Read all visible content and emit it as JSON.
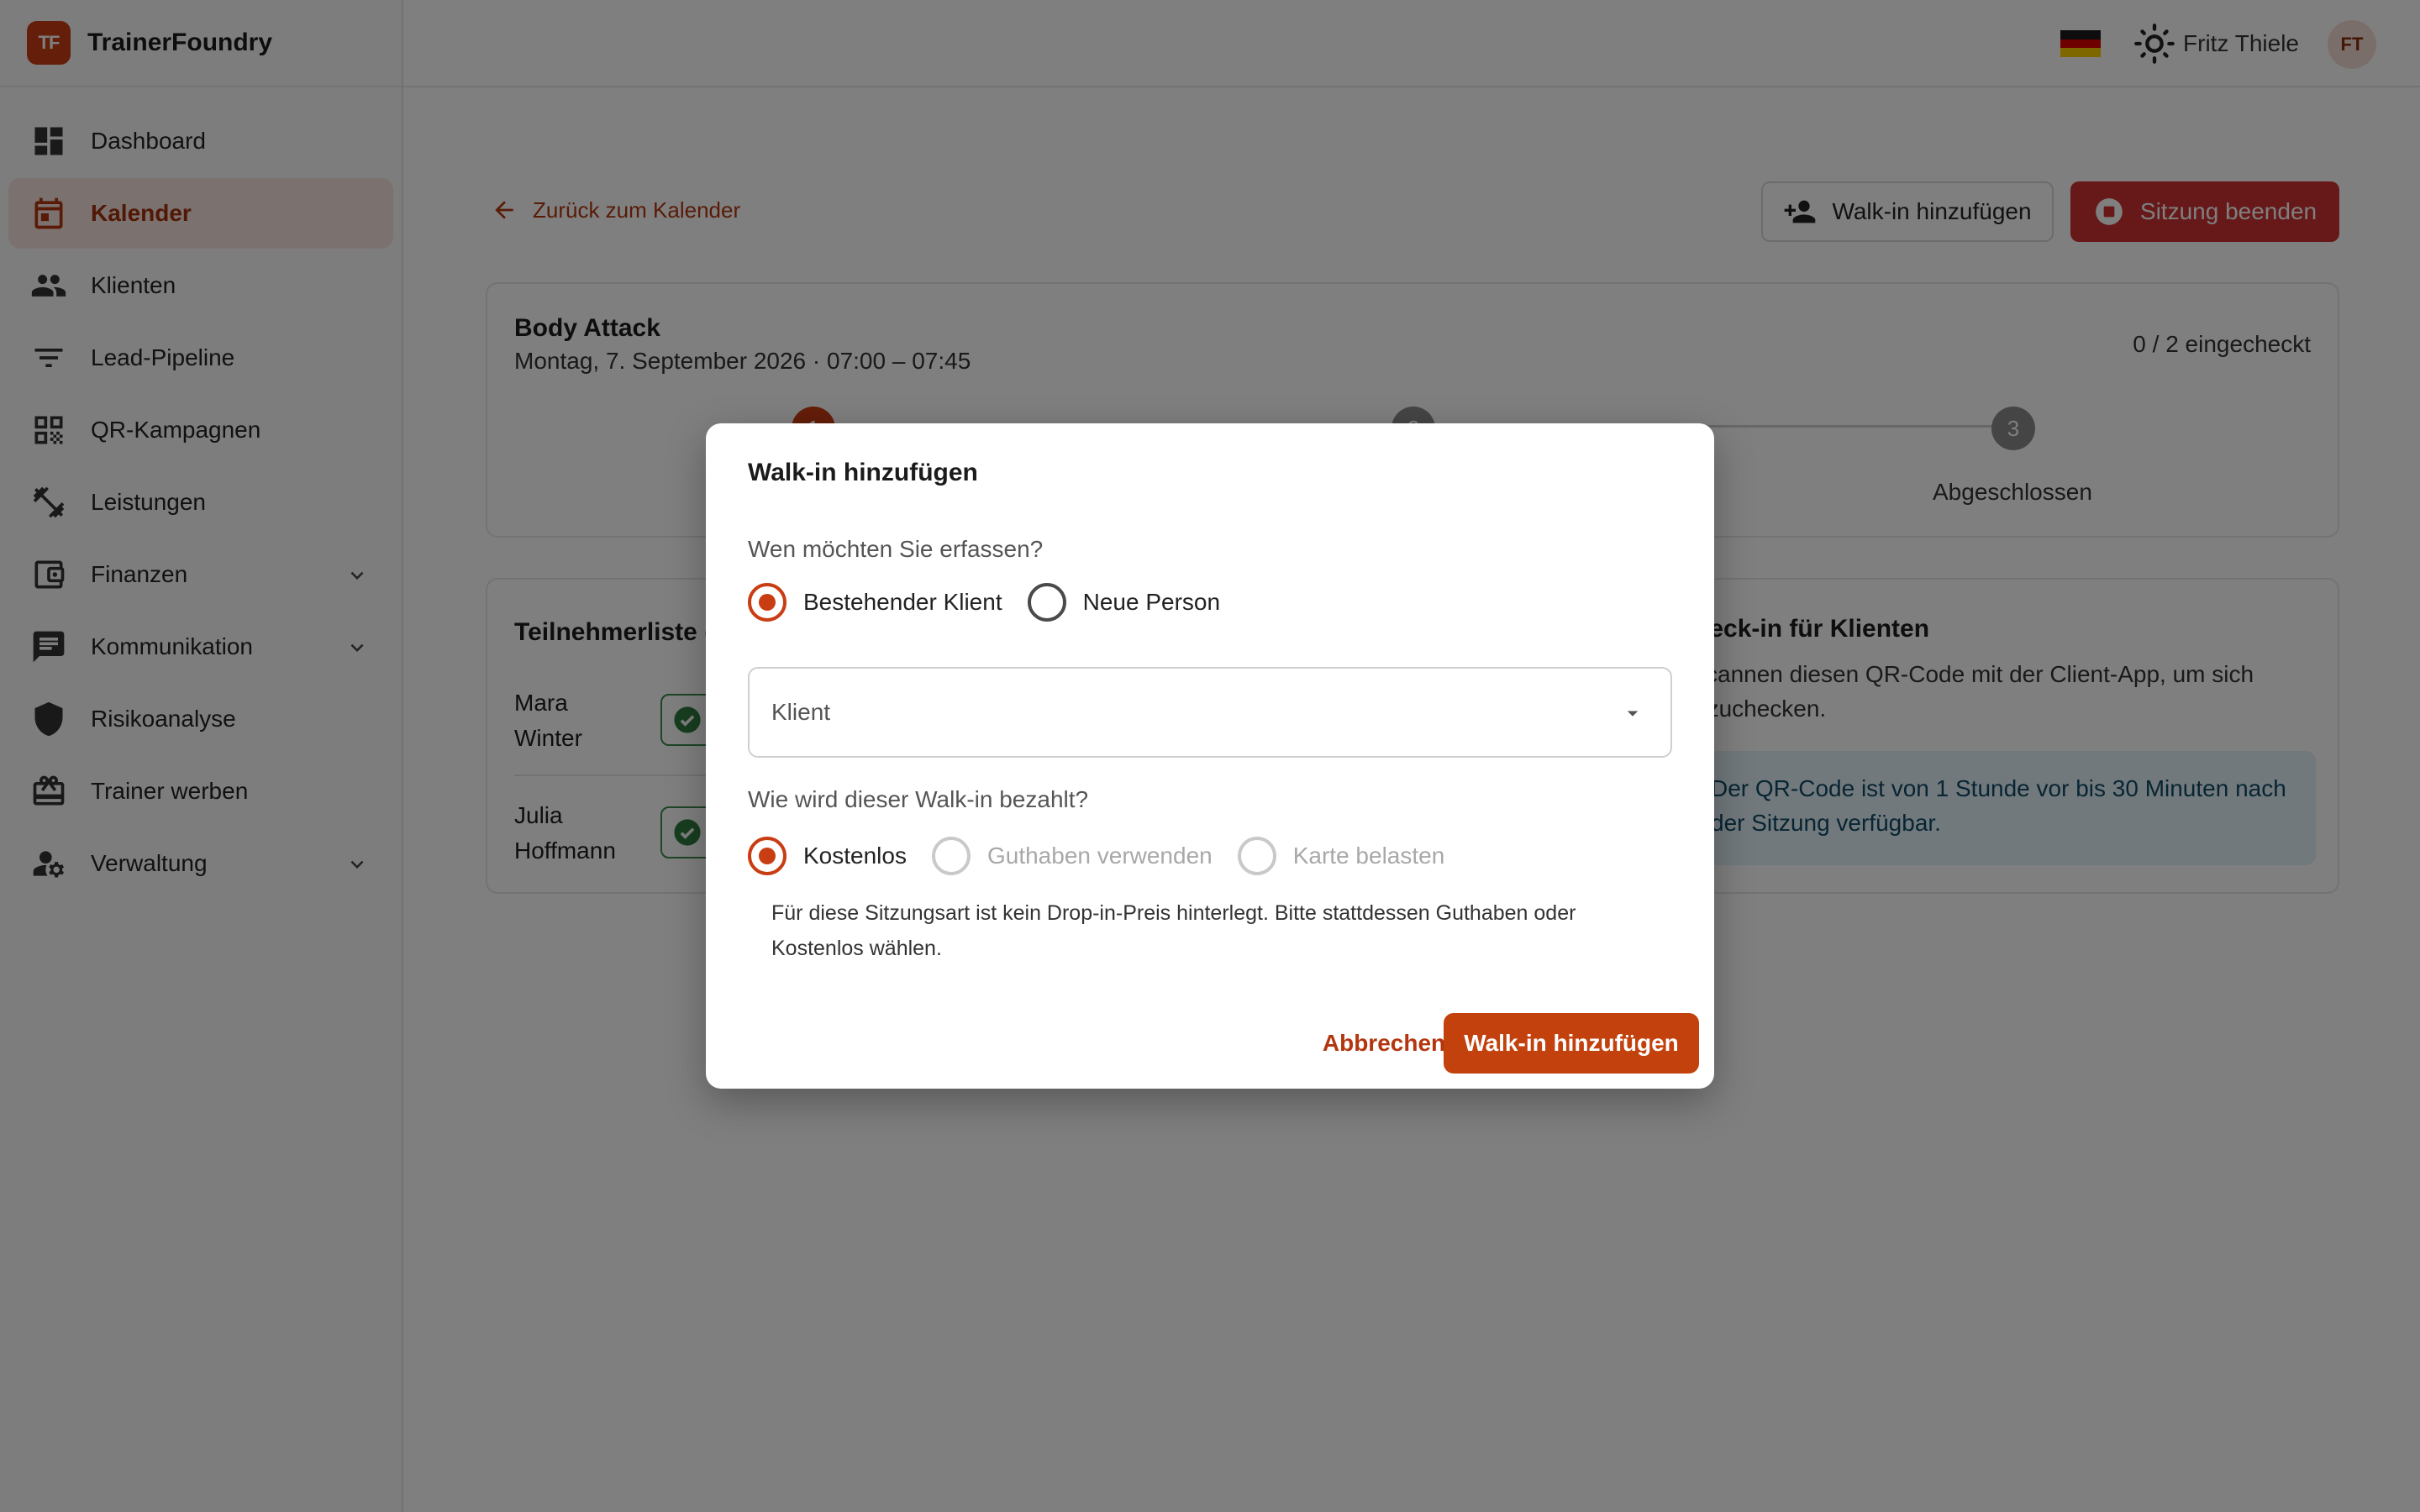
{
  "app": {
    "logo_text": "TF",
    "name": "TrainerFoundry"
  },
  "sidebar": {
    "items": [
      {
        "label": "Dashboard",
        "icon": "dashboard-icon"
      },
      {
        "label": "Kalender",
        "icon": "calendar-icon",
        "active": true
      },
      {
        "label": "Klienten",
        "icon": "people-icon"
      },
      {
        "label": "Lead-Pipeline",
        "icon": "filter-icon"
      },
      {
        "label": "QR-Kampagnen",
        "icon": "qr-code-icon"
      },
      {
        "label": "Leistungen",
        "icon": "fitness-icon"
      },
      {
        "label": "Finanzen",
        "icon": "wallet-icon",
        "expandable": true
      },
      {
        "label": "Kommunikation",
        "icon": "chat-icon",
        "expandable": true
      },
      {
        "label": "Risikoanalyse",
        "icon": "shield-icon"
      },
      {
        "label": "Trainer werben",
        "icon": "gift-icon"
      },
      {
        "label": "Verwaltung",
        "icon": "admin-icon",
        "expandable": true
      }
    ]
  },
  "topbar": {
    "language": "de",
    "user_name": "Fritz Thiele",
    "user_initials": "FT"
  },
  "page": {
    "back_label": "Zurück zum Kalender",
    "walkin_button": "Walk-in hinzufügen",
    "end_button": "Sitzung beenden",
    "session": {
      "title": "Body Attack",
      "subtitle": "Montag, 7. September 2026 · 07:00 – 07:45",
      "checked_in": "0 / 2 eingecheckt",
      "steps": [
        {
          "number": "1",
          "label": ""
        },
        {
          "number": "2",
          "label": ""
        },
        {
          "number": "3",
          "label": "Abgeschlossen"
        }
      ]
    },
    "participants": {
      "title": "Teilnehmerliste (",
      "rows": [
        {
          "first": "Mara",
          "last": "Winter"
        },
        {
          "first": "Julia",
          "last": "Hoffmann"
        }
      ]
    },
    "qr": {
      "title": "heck-in für Klienten",
      "text": "scannen diesen QR-Code mit der Client-App, um sich nzuchecken.",
      "info": "Der QR-Code ist von 1 Stunde vor bis 30 Minuten nach der Sitzung verfügbar."
    }
  },
  "dialog": {
    "title": "Walk-in hinzufügen",
    "who_question": "Wen möchten Sie erfassen?",
    "who_options": [
      "Bestehender Klient",
      "Neue Person"
    ],
    "who_selected": "Bestehender Klient",
    "client_placeholder": "Klient",
    "pay_question": "Wie wird dieser Walk-in bezahlt?",
    "pay_options": [
      "Kostenlos",
      "Guthaben verwenden",
      "Karte belasten"
    ],
    "pay_selected": "Kostenlos",
    "note": "Für diese Sitzungsart ist kein Drop-in-Preis hinterlegt. Bitte stattdessen Guthaben oder Kostenlos wählen.",
    "cancel": "Abbrechen",
    "submit": "Walk-in hinzufügen"
  }
}
